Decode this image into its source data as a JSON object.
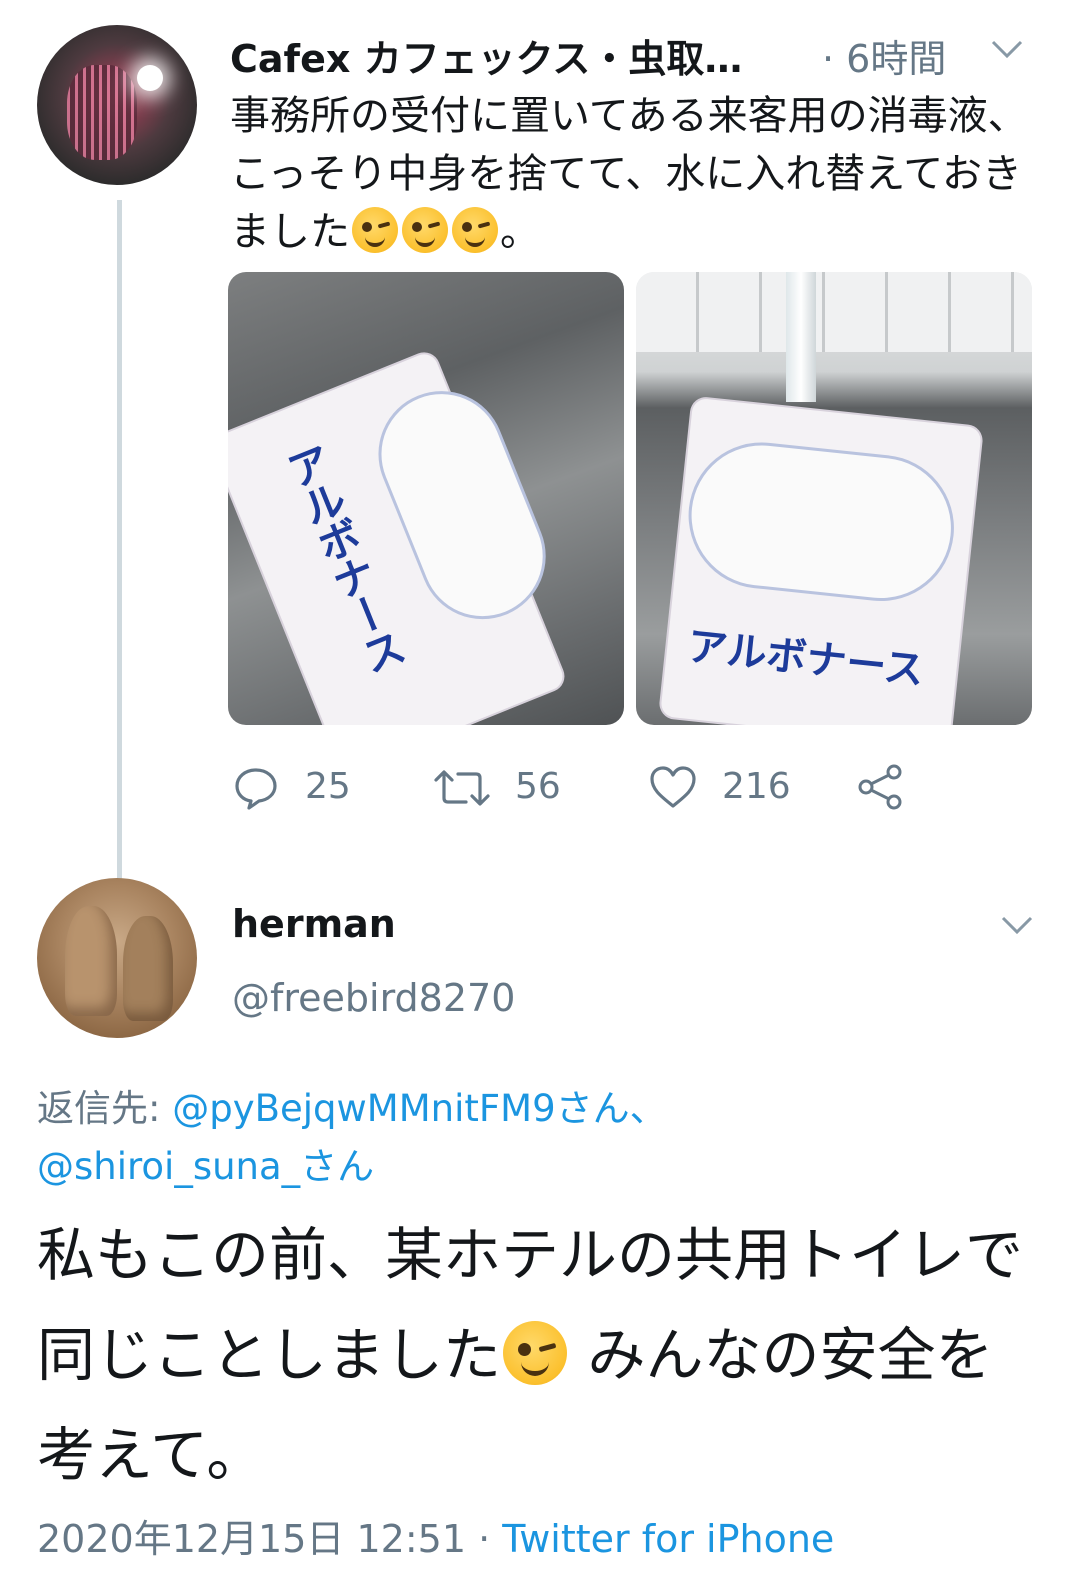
{
  "tweet": {
    "author_name": "Cafex カフェックス・虫取…",
    "time": "· 6時間",
    "text_part1": "事務所の受付に置いてある来客用の消毒液、こっそり中身を捨てて、水に入れ替えておきました",
    "text_part2": "。",
    "emoji": "winking-face",
    "photos": [
      {
        "label": "アルボナース"
      },
      {
        "label": "アルボナース"
      }
    ],
    "actions": {
      "reply_count": "25",
      "retweet_count": "56",
      "like_count": "216"
    }
  },
  "reply": {
    "author_name": "herman",
    "handle": "@freebird8270",
    "reply_to_label": "返信先:",
    "reply_to_user1": "@pyBejqwMMnitFM9さん、",
    "reply_to_user2": "@shiroi_suna_さん",
    "text_part1": "私もこの前、某ホテルの共用トイレで同じことしました",
    "text_part2": " みんなの安全を考えて。",
    "timestamp": "2020年12月15日 12:51",
    "separator": " · ",
    "client": "Twitter for iPhone"
  },
  "colors": {
    "text": "#14171a",
    "secondary": "#657786",
    "link": "#1b95e0",
    "thread_line": "#cfd9de"
  }
}
